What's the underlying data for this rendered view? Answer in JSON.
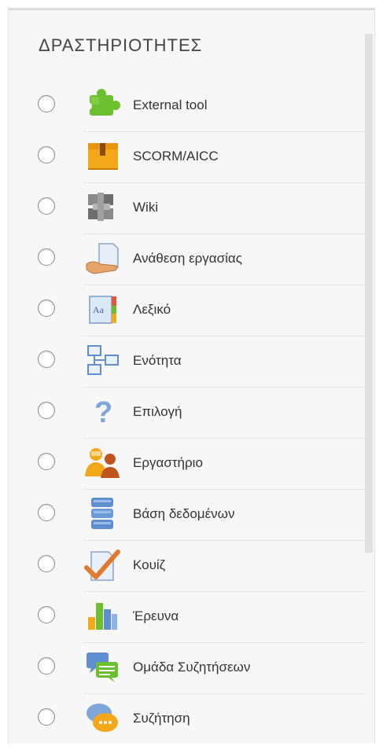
{
  "panel": {
    "title": "ΔΡΑΣΤΗΡΙΟΤΗΤΕΣ",
    "items": [
      {
        "label": "External tool",
        "icon": "puzzle-icon",
        "selected": false
      },
      {
        "label": "SCORM/AICC",
        "icon": "package-box-icon",
        "selected": false
      },
      {
        "label": "Wiki",
        "icon": "wiki-icon",
        "selected": false
      },
      {
        "label": "Ανάθεση εργασίας",
        "icon": "assignment-icon",
        "selected": false
      },
      {
        "label": "Λεξικό",
        "icon": "glossary-icon",
        "selected": false
      },
      {
        "label": "Ενότητα",
        "icon": "lesson-icon",
        "selected": false
      },
      {
        "label": "Επιλογή",
        "icon": "question-mark-icon",
        "selected": false
      },
      {
        "label": "Εργαστήριο",
        "icon": "workshop-icon",
        "selected": false
      },
      {
        "label": "Βάση δεδομένων",
        "icon": "database-icon",
        "selected": false
      },
      {
        "label": "Κουίζ",
        "icon": "quiz-checkmark-icon",
        "selected": false
      },
      {
        "label": "Έρευνα",
        "icon": "bar-chart-icon",
        "selected": false
      },
      {
        "label": "Ομάδα Συζητήσεων",
        "icon": "chat-group-icon",
        "selected": false
      },
      {
        "label": "Συζήτηση",
        "icon": "forum-bubbles-icon",
        "selected": false
      }
    ]
  }
}
